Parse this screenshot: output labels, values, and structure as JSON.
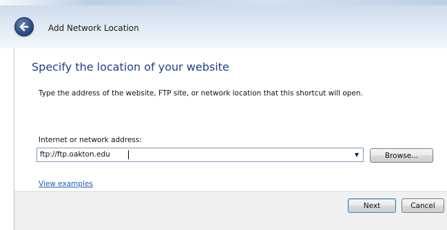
{
  "window": {
    "title": "Add Network Location"
  },
  "page": {
    "heading": "Specify the location of your website",
    "description": "Type the address of the website, FTP site, or network location that this shortcut will open.",
    "address_label": "Internet or network address:",
    "address_value": "ftp://ftp.oakton.edu",
    "browse_label": "Browse...",
    "view_examples_label": "View examples"
  },
  "footer": {
    "next_label": "Next",
    "cancel_label": "Cancel"
  },
  "icons": {
    "back": "back-arrow-icon",
    "dropdown": "chevron-down-icon"
  },
  "colors": {
    "heading": "#1f3f8a",
    "link": "#1f5bb5",
    "back_button": "#2c4c84"
  }
}
